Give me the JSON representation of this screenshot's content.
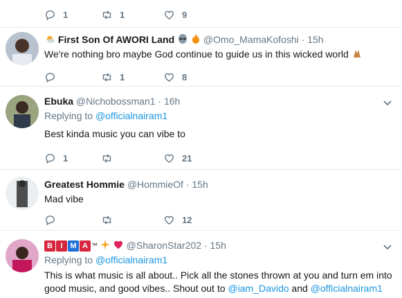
{
  "top_actions": {
    "reply_count": "1",
    "retweet_count": "1",
    "like_count": "9"
  },
  "tweets": [
    {
      "name": "First Son Of AWORI Land",
      "handle": "@Omo_MamaKofoshi",
      "time": "15h",
      "text": "We're nothing bro maybe God continue to guide us in this wicked world",
      "reply_count": "",
      "retweet_count": "1",
      "like_count": "8"
    },
    {
      "name": "Ebuka",
      "handle": "@Nichobossman1",
      "time": "16h",
      "replying_label": "Replying to",
      "replying_handle": "@officialnairam1",
      "text": "Best kinda music you can vibe to",
      "reply_count": "1",
      "retweet_count": "",
      "like_count": "21"
    },
    {
      "name": "Greatest Hommie",
      "handle": "@HommieOf",
      "time": "15h",
      "text": "Mad vibe",
      "reply_count": "",
      "retweet_count": "",
      "like_count": "12"
    },
    {
      "name_letters": [
        "B",
        "I",
        "M",
        "A"
      ],
      "name_suffix": "™",
      "handle": "@SharonStar202",
      "time": "15h",
      "replying_label": "Replying to",
      "replying_handle": "@officialnairam1",
      "text_line1": "This is what music is all about.. Pick all the stones thrown at you and turn em into",
      "text_line2_prefix": "good music, and  good vibes.. Shout out to ",
      "mention1": "@iam_Davido",
      "text_and": " and ",
      "mention2": "@officialnairam1"
    }
  ],
  "dot": "·",
  "colors": {
    "accent": "#1b95e0",
    "muted": "#657786",
    "divider": "#e6ecf0",
    "heart_red": "#e0245e"
  }
}
